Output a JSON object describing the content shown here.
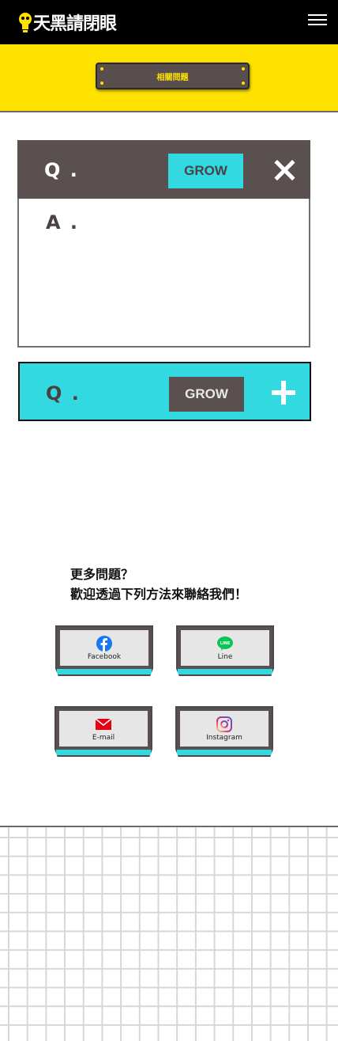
{
  "header": {
    "logo_text": "天黑請閉眼",
    "menu_icon": "hamburger-icon"
  },
  "banner": {
    "title": "相關問題"
  },
  "faq": [
    {
      "q_label": "Q .",
      "tag": "GROW",
      "a_label": "A .",
      "state": "expanded",
      "toggle_icon": "close-icon"
    },
    {
      "q_label": "Q .",
      "tag": "GROW",
      "state": "collapsed",
      "toggle_icon": "plus-icon"
    }
  ],
  "contact": {
    "line1": "更多問題？",
    "line2": "歡迎透過下列方法來聯絡我們！",
    "buttons": [
      {
        "label": "Facebook",
        "icon": "facebook-icon"
      },
      {
        "label": "Line",
        "icon": "line-icon"
      },
      {
        "label": "E-mail",
        "icon": "mail-icon"
      },
      {
        "label": "Instagram",
        "icon": "instagram-icon"
      }
    ]
  },
  "colors": {
    "header_bg": "#000000",
    "banner_bg": "#ffe100",
    "dark": "#5a504f",
    "cyan": "#33d9e1"
  }
}
